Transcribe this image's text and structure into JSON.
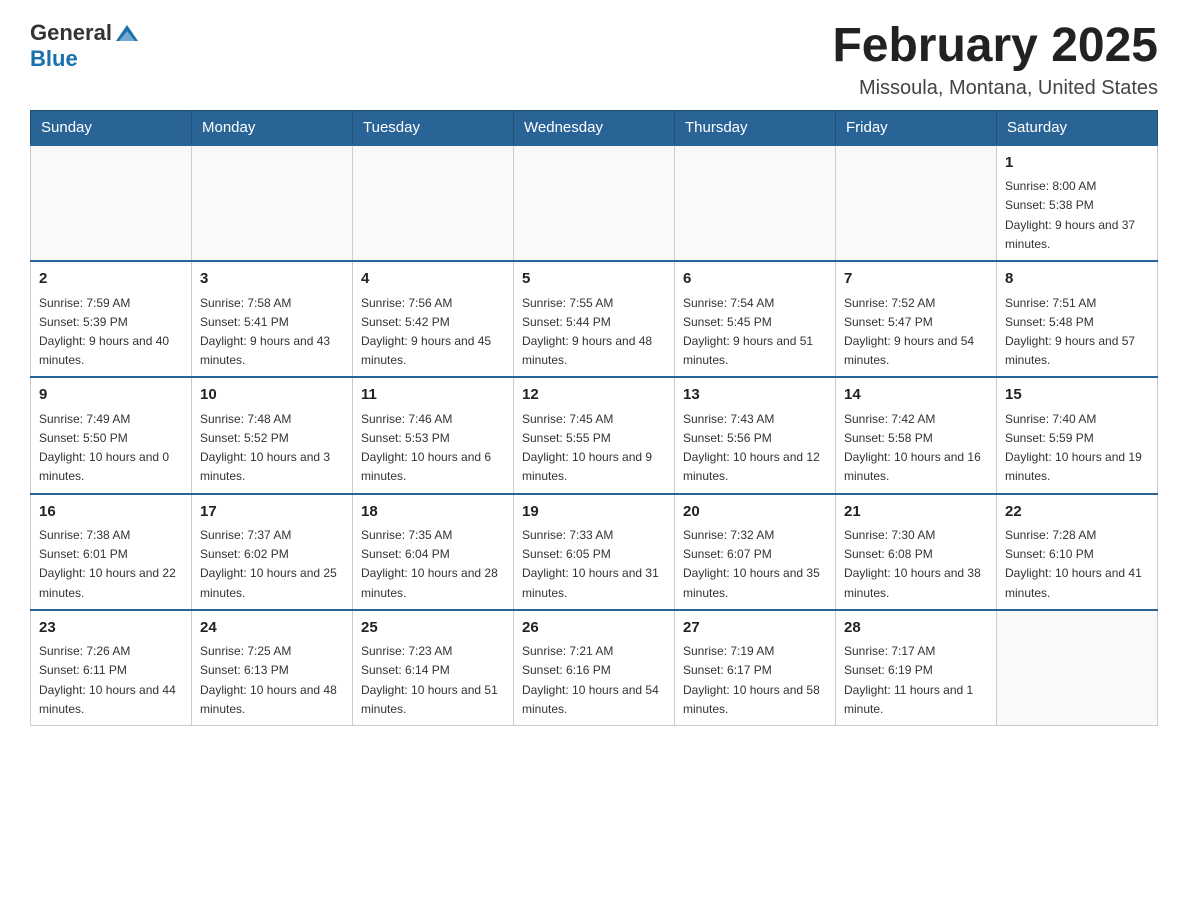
{
  "header": {
    "logo_general": "General",
    "logo_blue": "Blue",
    "month_title": "February 2025",
    "location": "Missoula, Montana, United States"
  },
  "days_of_week": [
    "Sunday",
    "Monday",
    "Tuesday",
    "Wednesday",
    "Thursday",
    "Friday",
    "Saturday"
  ],
  "weeks": [
    [
      {
        "day": "",
        "info": ""
      },
      {
        "day": "",
        "info": ""
      },
      {
        "day": "",
        "info": ""
      },
      {
        "day": "",
        "info": ""
      },
      {
        "day": "",
        "info": ""
      },
      {
        "day": "",
        "info": ""
      },
      {
        "day": "1",
        "info": "Sunrise: 8:00 AM\nSunset: 5:38 PM\nDaylight: 9 hours and 37 minutes."
      }
    ],
    [
      {
        "day": "2",
        "info": "Sunrise: 7:59 AM\nSunset: 5:39 PM\nDaylight: 9 hours and 40 minutes."
      },
      {
        "day": "3",
        "info": "Sunrise: 7:58 AM\nSunset: 5:41 PM\nDaylight: 9 hours and 43 minutes."
      },
      {
        "day": "4",
        "info": "Sunrise: 7:56 AM\nSunset: 5:42 PM\nDaylight: 9 hours and 45 minutes."
      },
      {
        "day": "5",
        "info": "Sunrise: 7:55 AM\nSunset: 5:44 PM\nDaylight: 9 hours and 48 minutes."
      },
      {
        "day": "6",
        "info": "Sunrise: 7:54 AM\nSunset: 5:45 PM\nDaylight: 9 hours and 51 minutes."
      },
      {
        "day": "7",
        "info": "Sunrise: 7:52 AM\nSunset: 5:47 PM\nDaylight: 9 hours and 54 minutes."
      },
      {
        "day": "8",
        "info": "Sunrise: 7:51 AM\nSunset: 5:48 PM\nDaylight: 9 hours and 57 minutes."
      }
    ],
    [
      {
        "day": "9",
        "info": "Sunrise: 7:49 AM\nSunset: 5:50 PM\nDaylight: 10 hours and 0 minutes."
      },
      {
        "day": "10",
        "info": "Sunrise: 7:48 AM\nSunset: 5:52 PM\nDaylight: 10 hours and 3 minutes."
      },
      {
        "day": "11",
        "info": "Sunrise: 7:46 AM\nSunset: 5:53 PM\nDaylight: 10 hours and 6 minutes."
      },
      {
        "day": "12",
        "info": "Sunrise: 7:45 AM\nSunset: 5:55 PM\nDaylight: 10 hours and 9 minutes."
      },
      {
        "day": "13",
        "info": "Sunrise: 7:43 AM\nSunset: 5:56 PM\nDaylight: 10 hours and 12 minutes."
      },
      {
        "day": "14",
        "info": "Sunrise: 7:42 AM\nSunset: 5:58 PM\nDaylight: 10 hours and 16 minutes."
      },
      {
        "day": "15",
        "info": "Sunrise: 7:40 AM\nSunset: 5:59 PM\nDaylight: 10 hours and 19 minutes."
      }
    ],
    [
      {
        "day": "16",
        "info": "Sunrise: 7:38 AM\nSunset: 6:01 PM\nDaylight: 10 hours and 22 minutes."
      },
      {
        "day": "17",
        "info": "Sunrise: 7:37 AM\nSunset: 6:02 PM\nDaylight: 10 hours and 25 minutes."
      },
      {
        "day": "18",
        "info": "Sunrise: 7:35 AM\nSunset: 6:04 PM\nDaylight: 10 hours and 28 minutes."
      },
      {
        "day": "19",
        "info": "Sunrise: 7:33 AM\nSunset: 6:05 PM\nDaylight: 10 hours and 31 minutes."
      },
      {
        "day": "20",
        "info": "Sunrise: 7:32 AM\nSunset: 6:07 PM\nDaylight: 10 hours and 35 minutes."
      },
      {
        "day": "21",
        "info": "Sunrise: 7:30 AM\nSunset: 6:08 PM\nDaylight: 10 hours and 38 minutes."
      },
      {
        "day": "22",
        "info": "Sunrise: 7:28 AM\nSunset: 6:10 PM\nDaylight: 10 hours and 41 minutes."
      }
    ],
    [
      {
        "day": "23",
        "info": "Sunrise: 7:26 AM\nSunset: 6:11 PM\nDaylight: 10 hours and 44 minutes."
      },
      {
        "day": "24",
        "info": "Sunrise: 7:25 AM\nSunset: 6:13 PM\nDaylight: 10 hours and 48 minutes."
      },
      {
        "day": "25",
        "info": "Sunrise: 7:23 AM\nSunset: 6:14 PM\nDaylight: 10 hours and 51 minutes."
      },
      {
        "day": "26",
        "info": "Sunrise: 7:21 AM\nSunset: 6:16 PM\nDaylight: 10 hours and 54 minutes."
      },
      {
        "day": "27",
        "info": "Sunrise: 7:19 AM\nSunset: 6:17 PM\nDaylight: 10 hours and 58 minutes."
      },
      {
        "day": "28",
        "info": "Sunrise: 7:17 AM\nSunset: 6:19 PM\nDaylight: 11 hours and 1 minute."
      },
      {
        "day": "",
        "info": ""
      }
    ]
  ]
}
